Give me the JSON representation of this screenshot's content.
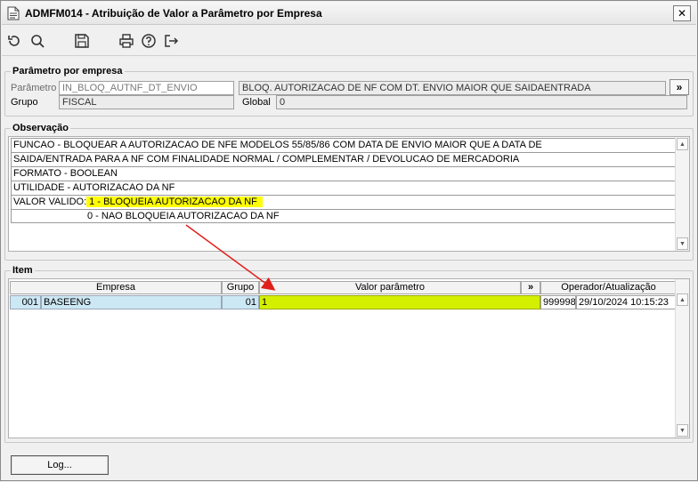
{
  "window": {
    "title": "ADMFM014 - Atribuição de Valor a Parâmetro por Empresa",
    "close_symbol": "✕"
  },
  "toolbar": {
    "icons": [
      "refresh-icon",
      "search-icon",
      "save-icon",
      "print-icon",
      "help-icon",
      "exit-icon"
    ]
  },
  "param_section": {
    "legend": "Parâmetro por empresa",
    "parametro_label": "Parâmetro",
    "parametro_value": "IN_BLOQ_AUTNF_DT_ENVIO",
    "descricao_value": "BLOQ. AUTORIZACAO DE NF COM DT. ENVIO MAIOR QUE SAIDAENTRADA",
    "more_label": "»",
    "grupo_label": "Grupo",
    "grupo_value": "FISCAL",
    "global_label": "Global",
    "global_value": "0"
  },
  "observacao": {
    "legend": "Observação",
    "lines": [
      "FUNCAO - BLOQUEAR A AUTORIZACAO DE NFE MODELOS 55/85/86 COM DATA DE ENVIO MAIOR QUE A DATA DE",
      "SAIDA/ENTRADA PARA A NF COM FINALIDADE NORMAL / COMPLEMENTAR / DEVOLUCAO DE MERCADORIA",
      "FORMATO - BOOLEAN",
      "UTILIDADE - AUTORIZACAO DA NF"
    ],
    "valor_prefix": "VALOR VALIDO:",
    "valor_1": " 1 - BLOQUEIA AUTORIZACAO DA NF",
    "valor_0": "0 - NAO BLOQUEIA AUTORIZACAO DA NF"
  },
  "item": {
    "legend": "Item",
    "headers": {
      "empresa": "Empresa",
      "grupo": "Grupo",
      "valor": "Valor parâmetro",
      "more": "»",
      "operador": "Operador/Atualização"
    },
    "row": {
      "codigo": "001",
      "empresa": "BASEENG",
      "grupo": "01",
      "valor": "1",
      "operador": "999998",
      "atualizacao": "29/10/2024 10:15:23"
    }
  },
  "footer": {
    "log_button": "Log..."
  },
  "colors": {
    "highlight_yellow": "#ffff00",
    "lime_cell": "#d4f000",
    "row_blue": "#cde8f5",
    "annotation_arrow": "#e0201c"
  }
}
